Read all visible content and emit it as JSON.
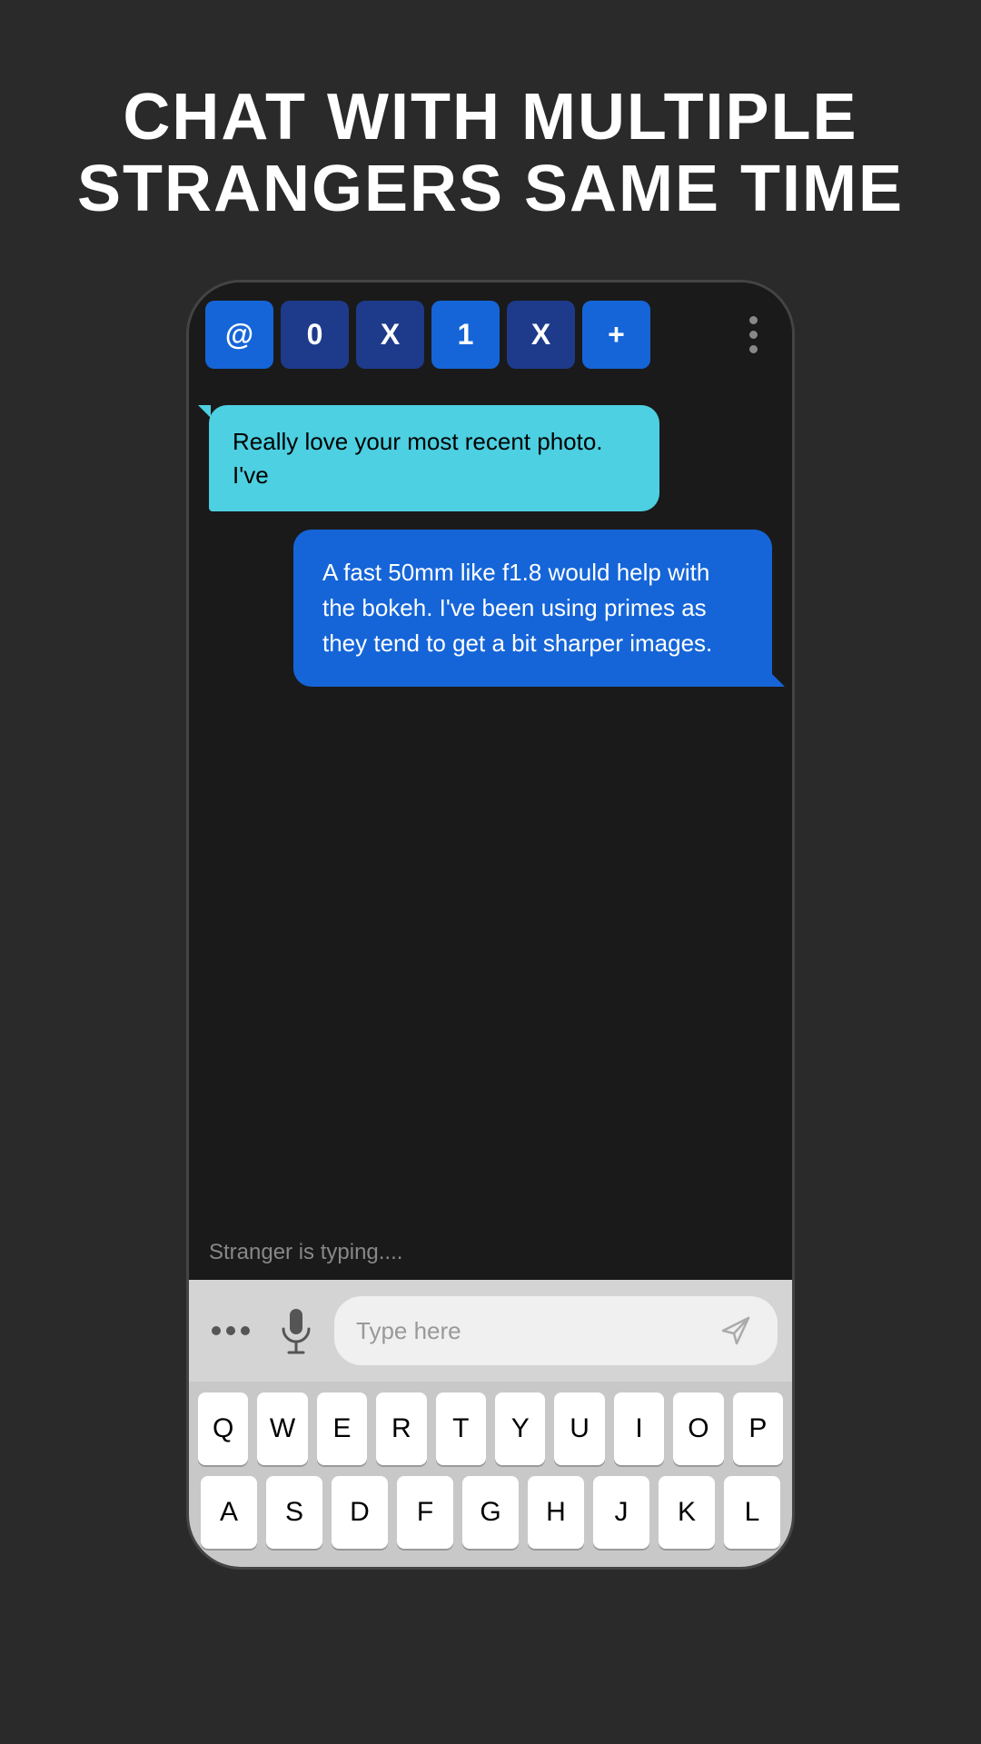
{
  "header": {
    "title_line1": "CHAT WITH MULTIPLE",
    "title_line2": "STRANGERS SAME TIME"
  },
  "tab_bar": {
    "tabs": [
      {
        "id": "at",
        "label": "@",
        "style": "active"
      },
      {
        "id": "zero",
        "label": "0",
        "style": "dark"
      },
      {
        "id": "x1",
        "label": "X",
        "style": "dark"
      },
      {
        "id": "one",
        "label": "1",
        "style": "active"
      },
      {
        "id": "x2",
        "label": "X",
        "style": "dark"
      },
      {
        "id": "plus",
        "label": "+",
        "style": "active"
      }
    ],
    "more_icon": "⋮"
  },
  "chat": {
    "messages": [
      {
        "type": "received",
        "text": "Really love your most recent photo. I've"
      },
      {
        "type": "sent",
        "text": "A fast 50mm like f1.8 would help with the bokeh. I've been using primes as they tend to get a bit sharper images."
      }
    ],
    "typing_text": "Stranger is typing...."
  },
  "input": {
    "placeholder": "Type here",
    "dots_label": "···",
    "send_icon": "send"
  },
  "keyboard": {
    "rows": [
      [
        "Q",
        "W",
        "E",
        "R",
        "T",
        "Y",
        "U",
        "I",
        "O",
        "P"
      ],
      [
        "A",
        "S",
        "D",
        "F",
        "G",
        "H",
        "J",
        "K",
        "L"
      ]
    ]
  }
}
